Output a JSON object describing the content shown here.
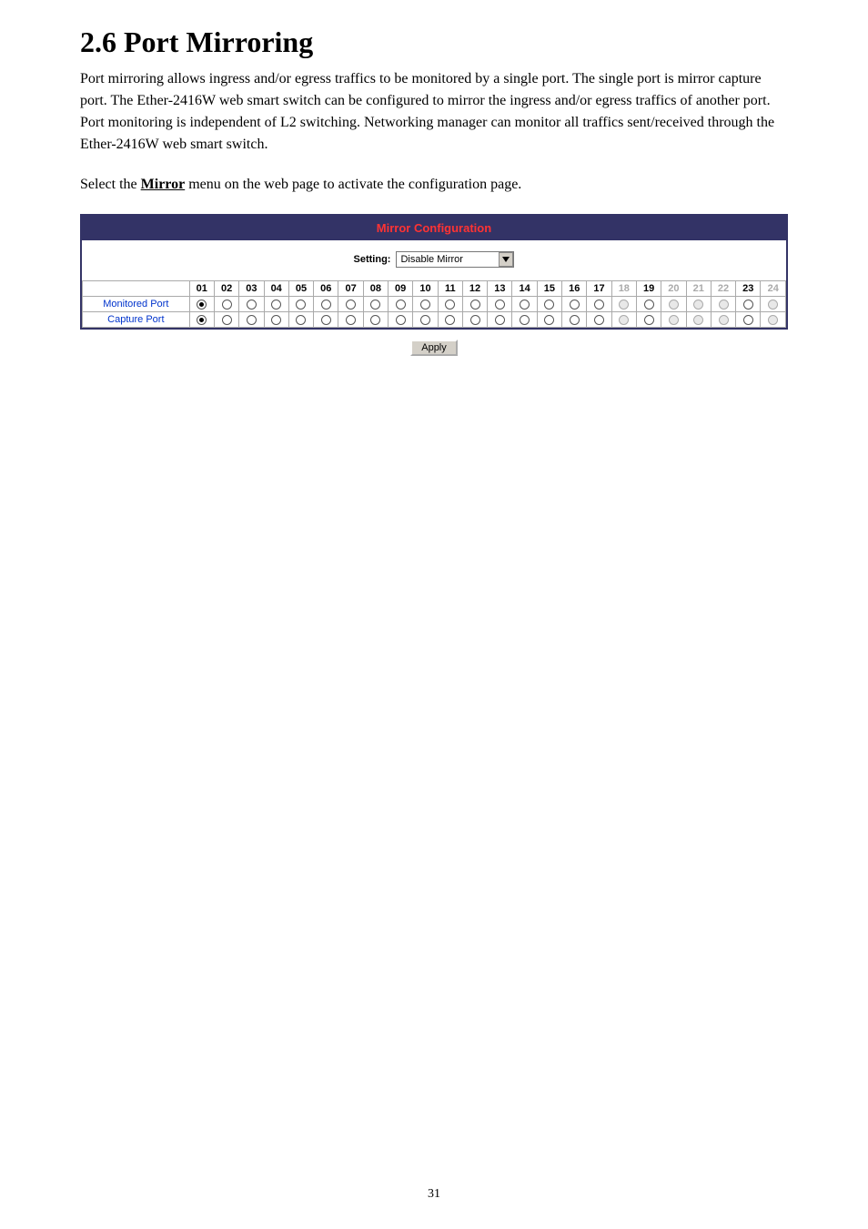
{
  "section": {
    "title": "2.6  Port Mirroring",
    "paragraph1": "Port mirroring allows ingress and/or egress traffics to be monitored by a single port. The single port is mirror capture port. The Ether-2416W web smart switch can be configured to mirror the ingress and/or egress traffics of another port. Port monitoring is independent of L2 switching. Networking manager can monitor all traffics sent/received through the Ether-2416W web smart switch.",
    "paragraph2_pre": "Select the ",
    "paragraph2_link": "Mirror",
    "paragraph2_post": " menu on the web page to activate the configuration page."
  },
  "panel": {
    "header": "Mirror Configuration",
    "setting_label": "Setting:",
    "setting_value": "Disable Mirror",
    "columns": [
      {
        "n": "01",
        "disabled": false
      },
      {
        "n": "02",
        "disabled": false
      },
      {
        "n": "03",
        "disabled": false
      },
      {
        "n": "04",
        "disabled": false
      },
      {
        "n": "05",
        "disabled": false
      },
      {
        "n": "06",
        "disabled": false
      },
      {
        "n": "07",
        "disabled": false
      },
      {
        "n": "08",
        "disabled": false
      },
      {
        "n": "09",
        "disabled": false
      },
      {
        "n": "10",
        "disabled": false
      },
      {
        "n": "11",
        "disabled": false
      },
      {
        "n": "12",
        "disabled": false
      },
      {
        "n": "13",
        "disabled": false
      },
      {
        "n": "14",
        "disabled": false
      },
      {
        "n": "15",
        "disabled": false
      },
      {
        "n": "16",
        "disabled": false
      },
      {
        "n": "17",
        "disabled": false
      },
      {
        "n": "18",
        "disabled": true
      },
      {
        "n": "19",
        "disabled": false
      },
      {
        "n": "20",
        "disabled": true
      },
      {
        "n": "21",
        "disabled": true
      },
      {
        "n": "22",
        "disabled": true
      },
      {
        "n": "23",
        "disabled": false
      },
      {
        "n": "24",
        "disabled": true
      }
    ],
    "rows": [
      {
        "label": "Monitored Port",
        "cells": [
          {
            "selected": true,
            "disabled": false
          },
          {
            "selected": false,
            "disabled": false
          },
          {
            "selected": false,
            "disabled": false
          },
          {
            "selected": false,
            "disabled": false
          },
          {
            "selected": false,
            "disabled": false
          },
          {
            "selected": false,
            "disabled": false
          },
          {
            "selected": false,
            "disabled": false
          },
          {
            "selected": false,
            "disabled": false
          },
          {
            "selected": false,
            "disabled": false
          },
          {
            "selected": false,
            "disabled": false
          },
          {
            "selected": false,
            "disabled": false
          },
          {
            "selected": false,
            "disabled": false
          },
          {
            "selected": false,
            "disabled": false
          },
          {
            "selected": false,
            "disabled": false
          },
          {
            "selected": false,
            "disabled": false
          },
          {
            "selected": false,
            "disabled": false
          },
          {
            "selected": false,
            "disabled": false
          },
          {
            "selected": false,
            "disabled": true
          },
          {
            "selected": false,
            "disabled": false
          },
          {
            "selected": false,
            "disabled": true
          },
          {
            "selected": false,
            "disabled": true
          },
          {
            "selected": false,
            "disabled": true
          },
          {
            "selected": false,
            "disabled": false
          },
          {
            "selected": false,
            "disabled": true
          }
        ]
      },
      {
        "label": "Capture Port",
        "cells": [
          {
            "selected": true,
            "disabled": false
          },
          {
            "selected": false,
            "disabled": false
          },
          {
            "selected": false,
            "disabled": false
          },
          {
            "selected": false,
            "disabled": false
          },
          {
            "selected": false,
            "disabled": false
          },
          {
            "selected": false,
            "disabled": false
          },
          {
            "selected": false,
            "disabled": false
          },
          {
            "selected": false,
            "disabled": false
          },
          {
            "selected": false,
            "disabled": false
          },
          {
            "selected": false,
            "disabled": false
          },
          {
            "selected": false,
            "disabled": false
          },
          {
            "selected": false,
            "disabled": false
          },
          {
            "selected": false,
            "disabled": false
          },
          {
            "selected": false,
            "disabled": false
          },
          {
            "selected": false,
            "disabled": false
          },
          {
            "selected": false,
            "disabled": false
          },
          {
            "selected": false,
            "disabled": false
          },
          {
            "selected": false,
            "disabled": true
          },
          {
            "selected": false,
            "disabled": false
          },
          {
            "selected": false,
            "disabled": true
          },
          {
            "selected": false,
            "disabled": true
          },
          {
            "selected": false,
            "disabled": true
          },
          {
            "selected": false,
            "disabled": false
          },
          {
            "selected": false,
            "disabled": true
          }
        ]
      }
    ],
    "apply_label": "Apply"
  },
  "page_number": "31"
}
